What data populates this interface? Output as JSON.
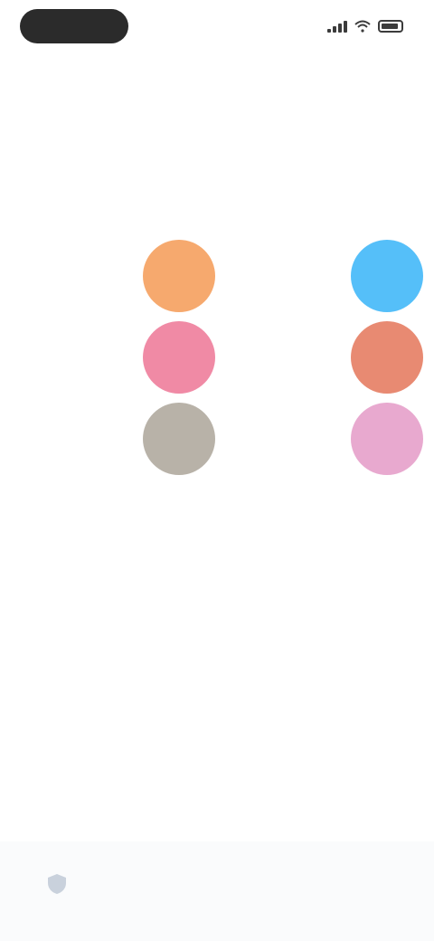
{
  "status_bar": {
    "time": "",
    "signal_icon": "signal-icon",
    "wifi_icon": "wifi-icon",
    "battery_icon": "battery-icon"
  },
  "page": {
    "title": "",
    "section_title": ""
  },
  "swatches": [
    {
      "label": "",
      "color": "#f6a96e"
    },
    {
      "label": "",
      "color": "#55bff9"
    },
    {
      "label": "",
      "color": "#f08aa5"
    },
    {
      "label": "",
      "color": "#e88a72"
    },
    {
      "label": "",
      "color": "#b8b2a8"
    },
    {
      "label": "",
      "color": "#e8a9cf"
    }
  ],
  "bottom_bar": {
    "icon": "shield-icon",
    "text": ""
  }
}
